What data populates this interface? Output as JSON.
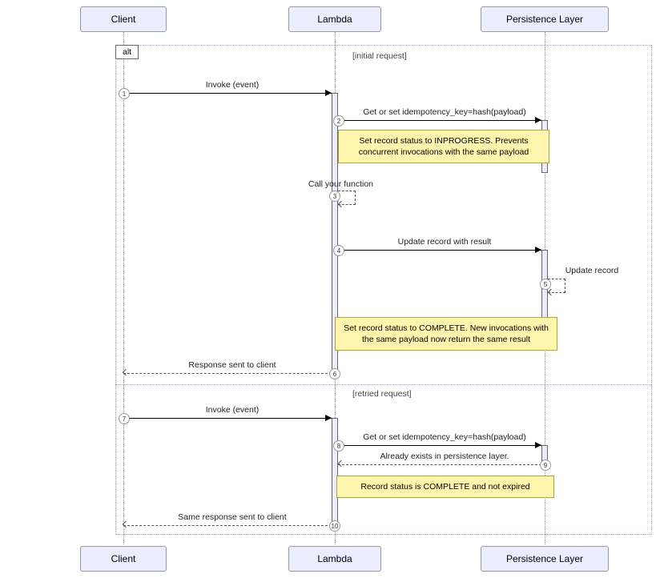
{
  "participants": {
    "client": "Client",
    "lambda": "Lambda",
    "persistence": "Persistence Layer"
  },
  "alt": {
    "label": "alt",
    "cond1": "[initial request]",
    "cond2": "[retried request]"
  },
  "messages": {
    "m1": "Invoke (event)",
    "m2": "Get or set idempotency_key=hash(payload)",
    "m3": "Call your function",
    "m4": "Update record with result",
    "m5": "Update record",
    "m6": "Response sent to client",
    "m7": "Invoke (event)",
    "m8": "Get or set idempotency_key=hash(payload)",
    "m9": "Already exists in persistence layer.",
    "m10": "Same response sent to client"
  },
  "notes": {
    "n1": "Set record status to INPROGRESS. Prevents concurrent invocations with the same payload",
    "n2": "Set record status to COMPLETE. New invocations with the same payload now return the same result",
    "n3": "Record status is COMPLETE and not expired"
  },
  "seq": {
    "s1": "1",
    "s2": "2",
    "s3": "3",
    "s4": "4",
    "s5": "5",
    "s6": "6",
    "s7": "7",
    "s8": "8",
    "s9": "9",
    "s10": "10"
  },
  "chart_data": {
    "type": "sequence_diagram",
    "participants": [
      "Client",
      "Lambda",
      "Persistence Layer"
    ],
    "fragments": [
      {
        "type": "alt",
        "operands": [
          {
            "guard": "initial request",
            "messages": [
              {
                "seq": 1,
                "from": "Client",
                "to": "Lambda",
                "label": "Invoke (event)",
                "style": "solid"
              },
              {
                "seq": 2,
                "from": "Lambda",
                "to": "Persistence Layer",
                "label": "Get or set idempotency_key=hash(payload)",
                "style": "solid"
              },
              {
                "note_over": [
                  "Lambda",
                  "Persistence Layer"
                ],
                "text": "Set record status to INPROGRESS. Prevents concurrent invocations with the same payload"
              },
              {
                "seq": 3,
                "from": "Lambda",
                "to": "Lambda",
                "label": "Call your function",
                "style": "dashed"
              },
              {
                "seq": 4,
                "from": "Lambda",
                "to": "Persistence Layer",
                "label": "Update record with result",
                "style": "solid"
              },
              {
                "seq": 5,
                "from": "Persistence Layer",
                "to": "Persistence Layer",
                "label": "Update record",
                "style": "dashed"
              },
              {
                "note_over": [
                  "Lambda",
                  "Persistence Layer"
                ],
                "text": "Set record status to COMPLETE. New invocations with the same payload now return the same result"
              },
              {
                "seq": 6,
                "from": "Lambda",
                "to": "Client",
                "label": "Response sent to client",
                "style": "dashed"
              }
            ]
          },
          {
            "guard": "retried request",
            "messages": [
              {
                "seq": 7,
                "from": "Client",
                "to": "Lambda",
                "label": "Invoke (event)",
                "style": "solid"
              },
              {
                "seq": 8,
                "from": "Lambda",
                "to": "Persistence Layer",
                "label": "Get or set idempotency_key=hash(payload)",
                "style": "solid"
              },
              {
                "seq": 9,
                "from": "Persistence Layer",
                "to": "Lambda",
                "label": "Already exists in persistence layer.",
                "style": "dashed"
              },
              {
                "note_over": [
                  "Lambda",
                  "Persistence Layer"
                ],
                "text": "Record status is COMPLETE and not expired"
              },
              {
                "seq": 10,
                "from": "Lambda",
                "to": "Client",
                "label": "Same response sent to client",
                "style": "dashed"
              }
            ]
          }
        ]
      }
    ]
  }
}
